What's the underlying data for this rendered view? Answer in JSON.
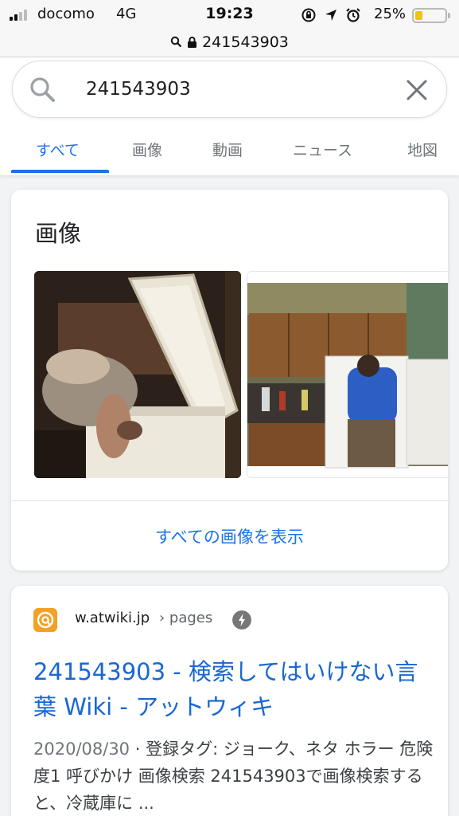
{
  "status_bar": {
    "carrier": "docomo",
    "network": "4G",
    "time": "19:23",
    "battery_percent": "25%",
    "battery_level": 0.25,
    "icons": [
      "signal-icon",
      "orientation-lock-icon",
      "location-arrow-icon",
      "alarm-icon",
      "battery-icon"
    ]
  },
  "browser": {
    "url": "241543903"
  },
  "search": {
    "query": "241543903"
  },
  "tabs": [
    {
      "label": "すべて",
      "active": true
    },
    {
      "label": "画像",
      "active": false
    },
    {
      "label": "動画",
      "active": false
    },
    {
      "label": "ニュース",
      "active": false
    },
    {
      "label": "地図",
      "active": false
    }
  ],
  "images_section": {
    "title": "画像",
    "show_all": "すべての画像を表示"
  },
  "result": {
    "host": "w.atwiki.jp",
    "path": "› pages",
    "title": "241543903 - 検索してはいけない言葉 Wiki - アットウィキ",
    "date": "2020/08/30",
    "snippet": " · 登録タグ: ジョーク、ネタ ホラー 危険度1 呼びかけ 画像検索 241543903で画像検索すると、冷蔵庫に ..."
  },
  "colors": {
    "accent": "#1a73e8",
    "link": "#1967d2",
    "logo": "#f4a024"
  }
}
